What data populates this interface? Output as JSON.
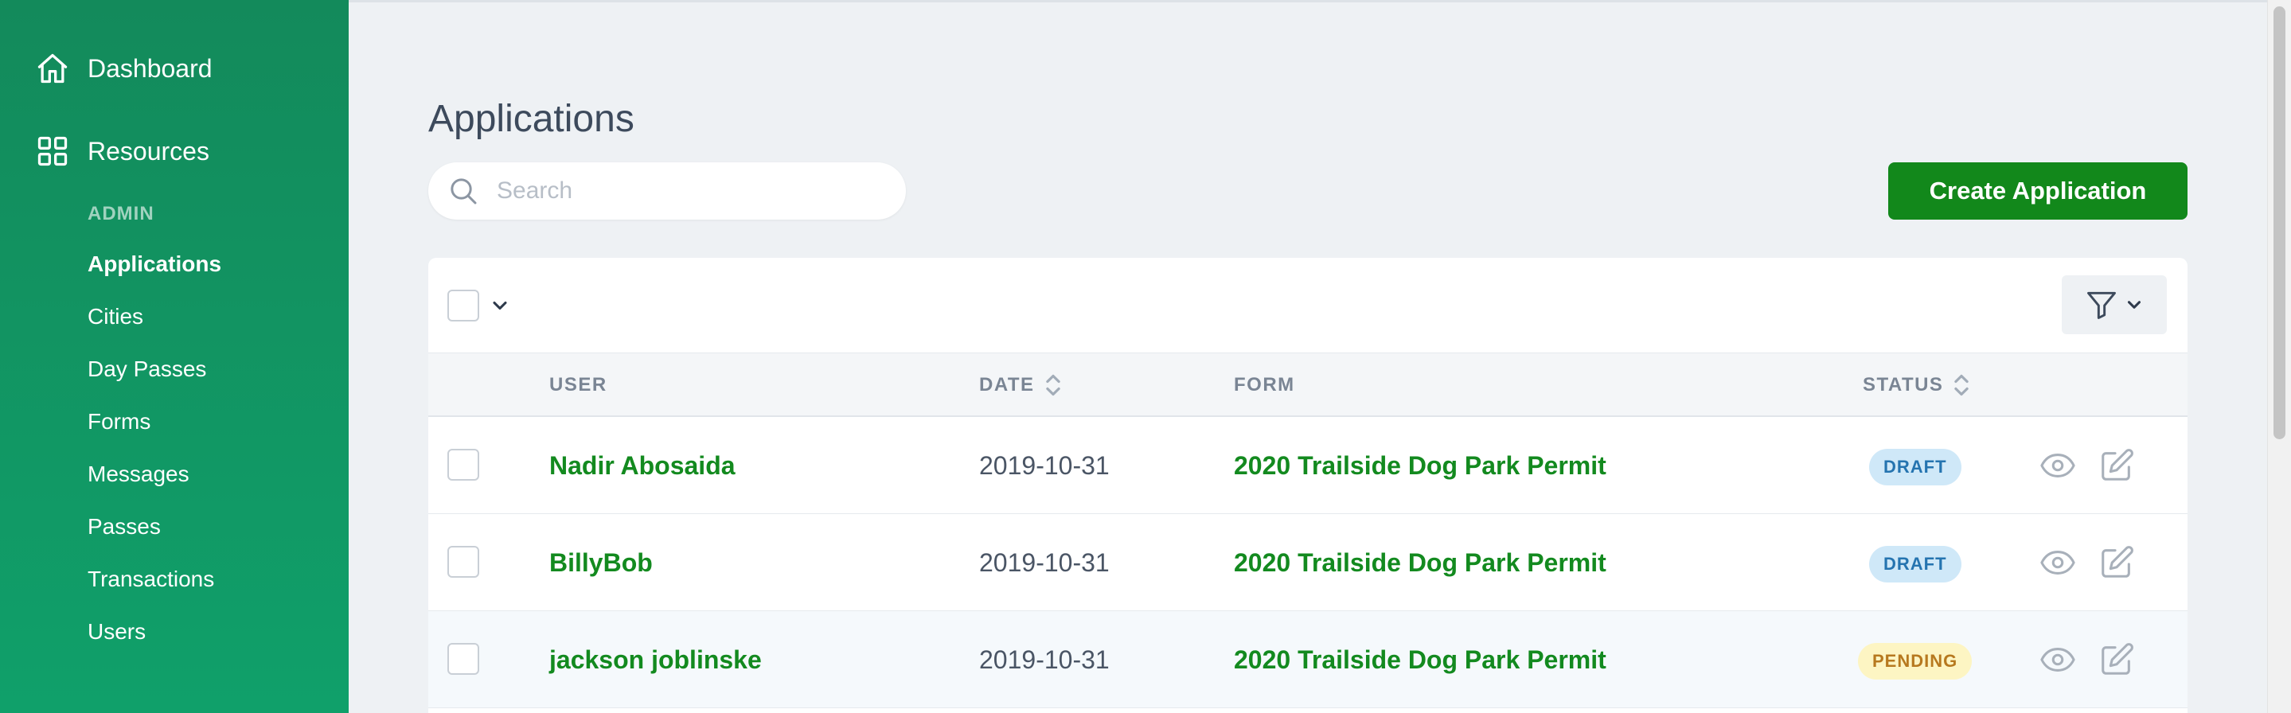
{
  "sidebar": {
    "dashboard_label": "Dashboard",
    "resources_label": "Resources",
    "section_heading": "ADMIN",
    "items": [
      {
        "label": "Applications",
        "active": true
      },
      {
        "label": "Cities"
      },
      {
        "label": "Day Passes"
      },
      {
        "label": "Forms"
      },
      {
        "label": "Messages"
      },
      {
        "label": "Passes"
      },
      {
        "label": "Transactions"
      },
      {
        "label": "Users"
      }
    ]
  },
  "page": {
    "title": "Applications",
    "search_placeholder": "Search",
    "create_button": "Create Application"
  },
  "table": {
    "headers": {
      "user": "USER",
      "date": "DATE",
      "form": "FORM",
      "status": "STATUS"
    },
    "rows": [
      {
        "user": "Nadir Abosaida",
        "date": "2019-10-31",
        "form": "2020 Trailside Dog Park Permit",
        "status": "DRAFT"
      },
      {
        "user": "BillyBob",
        "date": "2019-10-31",
        "form": "2020 Trailside Dog Park Permit",
        "status": "DRAFT"
      },
      {
        "user": "jackson joblinske",
        "date": "2019-10-31",
        "form": "2020 Trailside Dog Park Permit",
        "status": "PENDING"
      }
    ]
  },
  "icons": [
    "home-icon",
    "grid-icon",
    "search-icon",
    "chevron-down-icon",
    "filter-icon",
    "sort-icon",
    "eye-icon",
    "edit-icon"
  ],
  "colors": {
    "sidebar_top": "#138a5b",
    "sidebar_bottom": "#10a06a",
    "primary_button": "#12881b",
    "link_green": "#138a1f",
    "draft_badge_bg": "#cfe8f8",
    "draft_badge_text": "#2574b0",
    "pending_badge_bg": "#fdf5c3",
    "pending_badge_text": "#b7791f"
  }
}
